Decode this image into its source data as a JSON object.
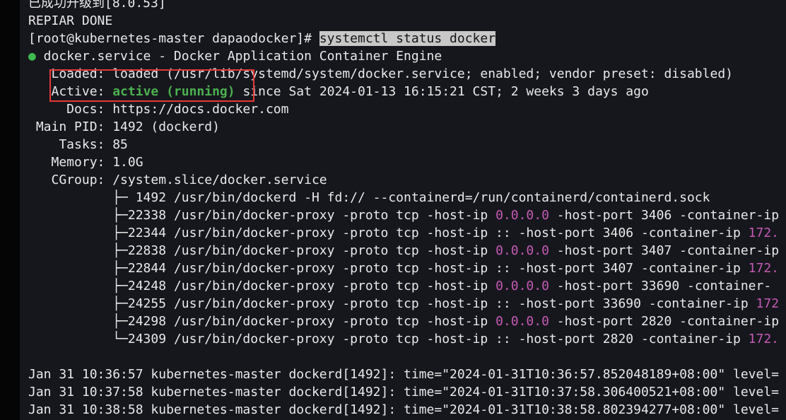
{
  "terminal": {
    "lines": {
      "l0": "已成功升级到[8.0.53]",
      "l1": "REPIAR DONE",
      "prompt": "[root@kubernetes-master dapaodocker]# ",
      "command": "systemctl status docker",
      "svc_dot": "●",
      "svc": " docker.service - Docker Application Container Engine",
      "loaded": "   Loaded: loaded (/usr/lib/systemd/system/docker.service; enabled; vendor preset: disabled)",
      "active_label": "   Active: ",
      "active_value": "active (running)",
      "active_rest": " since Sat 2024-01-13 16:15:21 CST; 2 weeks 3 days ago",
      "docs": "     Docs: https://docs.docker.com",
      "mainpid": " Main PID: 1492 (dockerd)",
      "tasks": "    Tasks: 85",
      "memory": "   Memory: 1.0G",
      "cgroup": "   CGroup: /system.slice/docker.service",
      "c1": "           ├─ 1492 /usr/bin/dockerd -H fd:// --containerd=/run/containerd/containerd.sock",
      "c2a": "           ├─22338 /usr/bin/docker-proxy -proto tcp -host-ip ",
      "c2ip": "0.0.0.0",
      "c2b": " -host-port 3406 -container-ip",
      "c3a": "           ├─22344 /usr/bin/docker-proxy -proto tcp -host-ip :: -host-port 3406 -container-ip ",
      "c3ip": "172.",
      "c4a": "           ├─22838 /usr/bin/docker-proxy -proto tcp -host-ip ",
      "c4ip": "0.0.0.0",
      "c4b": " -host-port 3407 -container-ip",
      "c5a": "           ├─22844 /usr/bin/docker-proxy -proto tcp -host-ip :: -host-port 3407 -container-ip ",
      "c5ip": "172.",
      "c6a": "           ├─24248 /usr/bin/docker-proxy -proto tcp -host-ip ",
      "c6ip": "0.0.0.0",
      "c6b": " -host-port 33690 -container-",
      "c7a": "           ├─24255 /usr/bin/docker-proxy -proto tcp -host-ip :: -host-port 33690 -container-ip ",
      "c7ip": "172",
      "c8a": "           ├─24298 /usr/bin/docker-proxy -proto tcp -host-ip ",
      "c8ip": "0.0.0.0",
      "c8b": " -host-port 2820 -container-ip",
      "c9a": "           └─24309 /usr/bin/docker-proxy -proto tcp -host-ip :: -host-port 2820 -container-ip ",
      "c9ip": "172.",
      "j1": "Jan 31 10:36:57 kubernetes-master dockerd[1492]: time=\"2024-01-31T10:36:57.852048189+08:00\" level=",
      "j2": "Jan 31 10:37:58 kubernetes-master dockerd[1492]: time=\"2024-01-31T10:37:58.306400521+08:00\" level=",
      "j3": "Jan 31 10:38:58 kubernetes-master dockerd[1492]: time=\"2024-01-31T10:38:58.802394277+08:00\" level="
    },
    "colors": {
      "active_green": "#4caf50",
      "ip_pink": "#c45ab3",
      "highlight_box": "#e53935"
    }
  }
}
